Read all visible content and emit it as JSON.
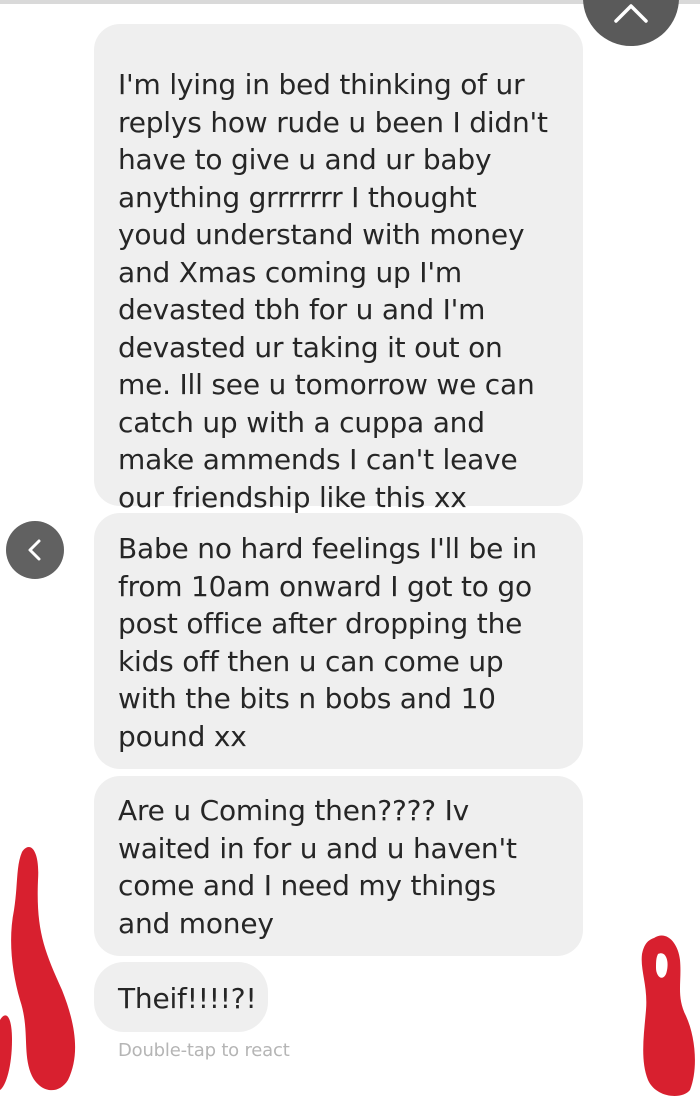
{
  "nav": {
    "close_icon": "close-chevron-icon",
    "back_icon": "chevron-left-icon"
  },
  "messages": [
    {
      "text": "I'm lying in bed thinking of ur\nreplys how rude u been I didn't\nhave to give u and ur baby\nanything grrrrrrr I thought\nyoud understand with money\nand Xmas coming up I'm\ndevasted tbh for u and I'm\ndevasted ur taking it out on\nme. Ill see u tomorrow we can\ncatch up with a cuppa and\nmake ammends I can't leave\nour friendship like this xx"
    },
    {
      "text": "Babe no hard feelings I'll be in\nfrom 10am onward I got to go\npost office after dropping the\nkids off then u can come up\nwith the bits n bobs and 10\npound xx"
    },
    {
      "text": "Are u Coming then???? Iv\nwaited in for u and u haven't\ncome and I need my things\nand money"
    },
    {
      "text": "Theif!!!!?!"
    }
  ],
  "hint": "Double-tap to react",
  "colors": {
    "bubble": "#efefef",
    "text": "#262626",
    "hint": "#b5b5b5",
    "button": "#5a5a5a",
    "scribble": "#d8202f"
  }
}
